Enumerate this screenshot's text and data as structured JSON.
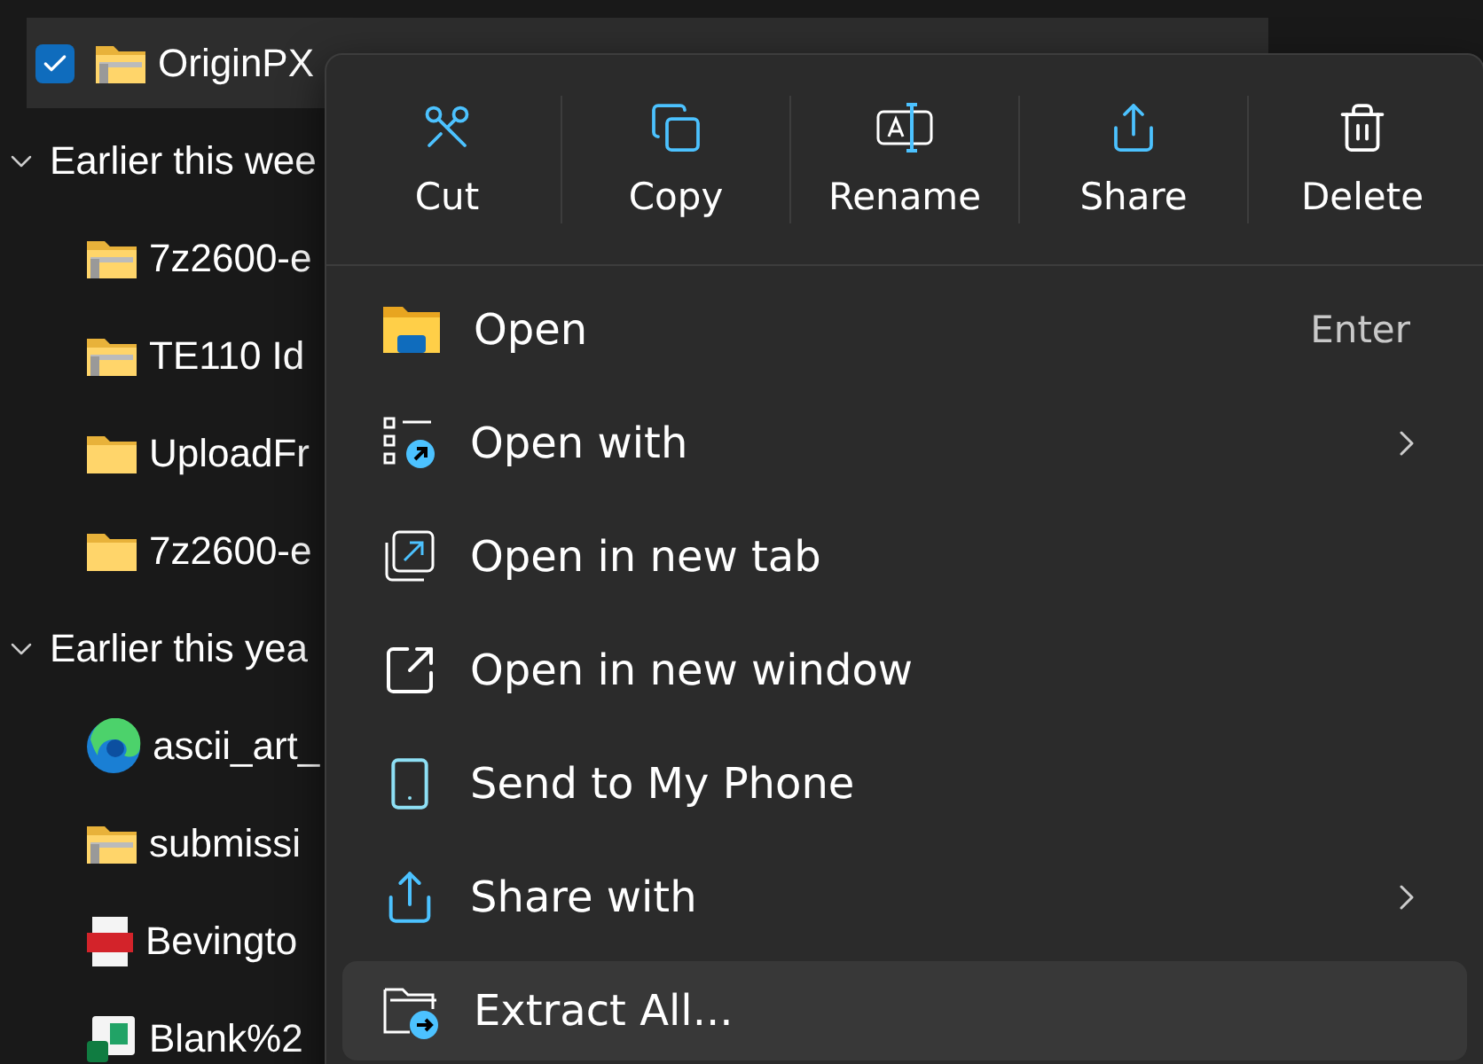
{
  "files": [
    {
      "kind": "zip",
      "name": "OriginPX",
      "selected": true
    },
    {
      "kind": "group",
      "name": "Earlier this wee",
      "expanded": true
    },
    {
      "kind": "zip",
      "name": "7z2600-e",
      "selected": false
    },
    {
      "kind": "zip",
      "name": "TE110 Id",
      "selected": false
    },
    {
      "kind": "folder",
      "name": "UploadFr",
      "selected": false
    },
    {
      "kind": "folder",
      "name": "7z2600-e",
      "selected": false
    },
    {
      "kind": "group",
      "name": "Earlier this yea",
      "expanded": true
    },
    {
      "kind": "edge",
      "name": "ascii_art_",
      "selected": false
    },
    {
      "kind": "zip",
      "name": "submissi",
      "selected": false
    },
    {
      "kind": "pdf",
      "name": "Bevingto",
      "selected": false
    },
    {
      "kind": "excel",
      "name": "Blank%2",
      "selected": false
    }
  ],
  "context_menu": {
    "toolbar": [
      {
        "label": "Cut"
      },
      {
        "label": "Copy"
      },
      {
        "label": "Rename"
      },
      {
        "label": "Share"
      },
      {
        "label": "Delete"
      }
    ],
    "items": [
      {
        "label": "Open",
        "shortcut": "Enter",
        "submenu": false,
        "selected": false
      },
      {
        "label": "Open with",
        "submenu": true,
        "selected": false
      },
      {
        "label": "Open in new tab",
        "submenu": false,
        "selected": false
      },
      {
        "label": "Open in new window",
        "submenu": false,
        "selected": false
      },
      {
        "label": "Send to My Phone",
        "submenu": false,
        "selected": false
      },
      {
        "label": "Share with",
        "submenu": true,
        "selected": false
      },
      {
        "label": "Extract All...",
        "submenu": false,
        "selected": true
      }
    ]
  }
}
